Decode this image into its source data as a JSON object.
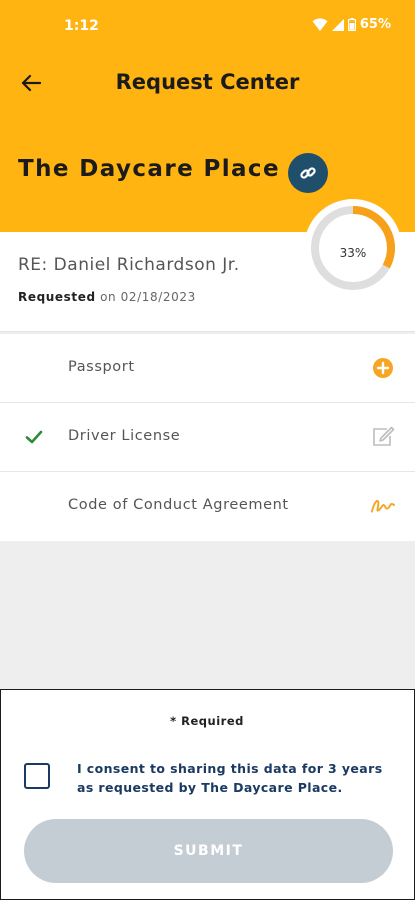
{
  "status_bar": {
    "time": "1:12",
    "battery": "65%"
  },
  "header": {
    "title": "Request Center",
    "org_name": "The Daycare Place",
    "accent_color": "#ffb411",
    "link_button_color": "#1f4f6a"
  },
  "request": {
    "re_label": "RE: Daniel Richardson Jr.",
    "requested_label": "Requested",
    "requested_suffix": "on 02/18/2023",
    "progress_text": "33%",
    "progress_value": 0.33
  },
  "documents": [
    {
      "label": "Passport",
      "checked": false,
      "action_icon": "add-circle-icon"
    },
    {
      "label": "Driver License",
      "checked": true,
      "action_icon": "edit-icon"
    },
    {
      "label": "Code of Conduct Agreement",
      "checked": false,
      "action_icon": "signature-icon"
    }
  ],
  "consent": {
    "required_note": "* Required",
    "text": "I consent to sharing this data for 3 years as requested by The Daycare Place.",
    "submit_label": "SUBMIT",
    "submit_color": "#c5cdd4"
  }
}
